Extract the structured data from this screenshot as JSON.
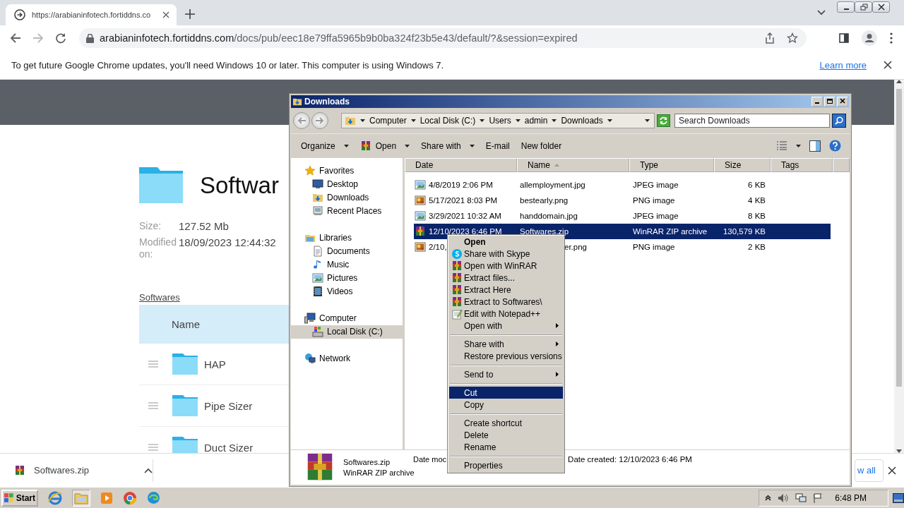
{
  "browser": {
    "tab": {
      "title": "https://arabianinfotech.fortiddns.co"
    },
    "address": {
      "domain": "arabianinfotech.fortiddns.com",
      "path": "/docs/pub/eec18e79ffa5965b9b0ba324f23b5e43/default/?&session=expired"
    },
    "infobar": {
      "message": "To get future Google Chrome updates, you'll need Windows 10 or later. This computer is using Windows 7.",
      "link": "Learn more"
    }
  },
  "page": {
    "folder_title": "Softwar",
    "details": [
      {
        "label": "Size:",
        "value": "127.52 Mb"
      },
      {
        "label": "Modified on:",
        "value": "18/09/2023 12:44:32"
      }
    ],
    "breadcrumb": "Softwares",
    "table": {
      "columns": [
        "Name"
      ],
      "rows": [
        {
          "name": "HAP"
        },
        {
          "name": "Pipe Sizer"
        },
        {
          "name": "Duct Sizer"
        }
      ]
    }
  },
  "downloads": {
    "items": [
      {
        "name": "Softwares.zip"
      }
    ],
    "show_all": "w all"
  },
  "explorer": {
    "title": "Downloads",
    "breadcrumb": [
      "Computer",
      "Local Disk (C:)",
      "Users",
      "admin",
      "Downloads"
    ],
    "search": {
      "placeholder": "Search Downloads"
    },
    "commands": [
      {
        "label": "Organize",
        "kind": "menu"
      },
      {
        "label": "Open",
        "kind": "archive-menu"
      },
      {
        "label": "Share with",
        "kind": "menu"
      },
      {
        "label": "E-mail",
        "kind": "plain"
      },
      {
        "label": "New folder",
        "kind": "plain"
      }
    ],
    "nav": [
      {
        "label": "Favorites",
        "kind": "favorites",
        "selected": false,
        "children": [
          {
            "label": "Desktop",
            "kind": "desktop",
            "selected": false
          },
          {
            "label": "Downloads",
            "kind": "downloads",
            "selected": false
          },
          {
            "label": "Recent Places",
            "kind": "recent",
            "selected": false
          }
        ]
      },
      {
        "label": "Libraries",
        "kind": "libraries",
        "selected": false,
        "children": [
          {
            "label": "Documents",
            "kind": "documents",
            "selected": false
          },
          {
            "label": "Music",
            "kind": "music",
            "selected": false
          },
          {
            "label": "Pictures",
            "kind": "pictures",
            "selected": false
          },
          {
            "label": "Videos",
            "kind": "videos",
            "selected": false
          }
        ]
      },
      {
        "label": "Computer",
        "kind": "computer",
        "selected": false,
        "children": [
          {
            "label": "Local Disk (C:)",
            "kind": "disk",
            "selected": true
          }
        ]
      },
      {
        "label": "Network",
        "kind": "network",
        "selected": false
      }
    ],
    "columns": [
      {
        "label": "Date",
        "sorted": false
      },
      {
        "label": "Name",
        "sorted": true
      },
      {
        "label": "Type",
        "sorted": false
      },
      {
        "label": "Size",
        "sorted": false
      },
      {
        "label": "Tags",
        "sorted": false
      }
    ],
    "files": [
      {
        "date": "4/8/2019 2:06 PM",
        "name": "allemployment.jpg",
        "type": "JPEG image",
        "size": "6 KB",
        "kind": "jpeg",
        "selected": false,
        "covered": false
      },
      {
        "date": "5/17/2021 8:03 PM",
        "name": "bestearly.png",
        "type": "PNG image",
        "size": "4 KB",
        "kind": "png",
        "selected": false,
        "covered": false
      },
      {
        "date": "3/29/2021 10:32 AM",
        "name": "handdomain.jpg",
        "type": "JPEG image",
        "size": "8 KB",
        "kind": "jpeg",
        "selected": false,
        "covered": false
      },
      {
        "date": "12/10/2023 6:46 PM",
        "name": "Softwares.zip",
        "type": "WinRAR ZIP archive",
        "size": "130,579 KB",
        "kind": "zip",
        "selected": true,
        "covered": false
      },
      {
        "date": "2/10,",
        "name": "er.png",
        "type": "PNG image",
        "size": "2 KB",
        "kind": "png",
        "selected": false,
        "covered": true
      }
    ],
    "details_pane": {
      "name": "Softwares.zip",
      "type": "WinRAR ZIP archive",
      "date_modified": "Date moc",
      "date_created": "Date created: 12/10/2023 6:46 PM"
    }
  },
  "context_menu": {
    "items": [
      {
        "kind": "plain",
        "label": "Open",
        "default": true,
        "submenu": false,
        "selected": false
      },
      {
        "kind": "skype",
        "label": "Share with Skype",
        "default": false,
        "submenu": false,
        "selected": false
      },
      {
        "kind": "archive",
        "label": "Open with WinRAR",
        "default": false,
        "submenu": false,
        "selected": false
      },
      {
        "kind": "archive",
        "label": "Extract files...",
        "default": false,
        "submenu": false,
        "selected": false
      },
      {
        "kind": "archive",
        "label": "Extract Here",
        "default": false,
        "submenu": false,
        "selected": false
      },
      {
        "kind": "archive",
        "label": "Extract to Softwares\\",
        "default": false,
        "submenu": false,
        "selected": false
      },
      {
        "kind": "notepad",
        "label": "Edit with Notepad++",
        "default": false,
        "submenu": false,
        "selected": false
      },
      {
        "kind": "plain",
        "label": "Open with",
        "default": false,
        "submenu": true,
        "selected": false
      },
      {
        "kind": "separator"
      },
      {
        "kind": "plain",
        "label": "Share with",
        "default": false,
        "submenu": true,
        "selected": false
      },
      {
        "kind": "plain",
        "label": "Restore previous versions",
        "default": false,
        "submenu": false,
        "selected": false
      },
      {
        "kind": "separator"
      },
      {
        "kind": "plain",
        "label": "Send to",
        "default": false,
        "submenu": true,
        "selected": false
      },
      {
        "kind": "separator"
      },
      {
        "kind": "plain",
        "label": "Cut",
        "default": false,
        "submenu": false,
        "selected": true
      },
      {
        "kind": "plain",
        "label": "Copy",
        "default": false,
        "submenu": false,
        "selected": false
      },
      {
        "kind": "separator"
      },
      {
        "kind": "plain",
        "label": "Create shortcut",
        "default": false,
        "submenu": false,
        "selected": false
      },
      {
        "kind": "plain",
        "label": "Delete",
        "default": false,
        "submenu": false,
        "selected": false
      },
      {
        "kind": "plain",
        "label": "Rename",
        "default": false,
        "submenu": false,
        "selected": false
      },
      {
        "kind": "separator"
      },
      {
        "kind": "plain",
        "label": "Properties",
        "default": false,
        "submenu": false,
        "selected": false
      }
    ]
  },
  "taskbar": {
    "start": "Start",
    "clock": "6:48 PM"
  }
}
